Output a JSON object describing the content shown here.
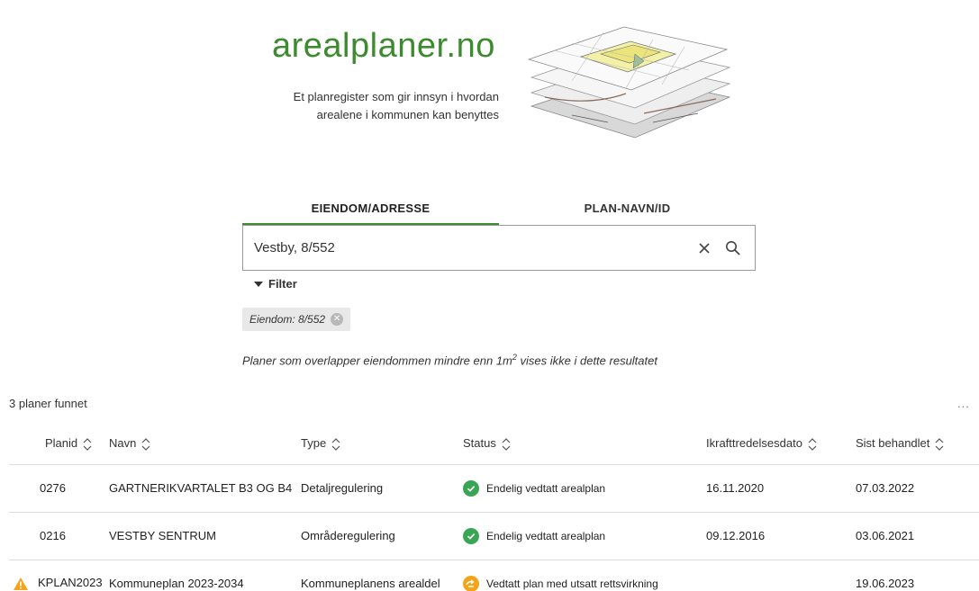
{
  "header": {
    "title": "arealplaner.no",
    "subtitle": "Et planregister som gir innsyn i hvordan arealene i kommunen kan benyttes"
  },
  "tabs": [
    {
      "label": "EIENDOM/ADRESSE",
      "active": true
    },
    {
      "label": "PLAN-NAVN/ID",
      "active": false
    }
  ],
  "search": {
    "value": "Vestby, 8/552",
    "clear_icon": "close-icon",
    "search_icon": "search-icon"
  },
  "filter": {
    "label": "Filter",
    "chip_label": "Eiendom: 8/552"
  },
  "note": {
    "before": "Planer som overlapper eiendommen mindre enn 1m",
    "sup": "2",
    "after": " vises ikke i dette resultatet"
  },
  "results": {
    "count_label": "3 planer funnet",
    "more_label": "...",
    "columns": [
      "Planid",
      "Navn",
      "Type",
      "Status",
      "Ikrafttredelsesdato",
      "Sist behandlet"
    ],
    "rows": [
      {
        "planid": "0276",
        "navn": "GARTNERIKVARTALET B3 OG B4",
        "type": "Detaljregulering",
        "status": "Endelig vedtatt arealplan",
        "status_kind": "approved",
        "ikraft": "16.11.2020",
        "sist": "07.03.2022",
        "warning": false
      },
      {
        "planid": "0216",
        "navn": "VESTBY SENTRUM",
        "type": "Områderegulering",
        "status": "Endelig vedtatt arealplan",
        "status_kind": "approved",
        "ikraft": "09.12.2016",
        "sist": "03.06.2021",
        "warning": false
      },
      {
        "planid": "KPLAN2023",
        "navn": "Kommuneplan 2023-2034",
        "type": "Kommuneplanens arealdel",
        "status": "Vedtatt plan med utsatt rettsvirkning",
        "status_kind": "deferred",
        "ikraft": "",
        "sist": "19.06.2023",
        "warning": true
      }
    ]
  },
  "colors": {
    "brand": "#3d8b2f",
    "approved": "#3aa655",
    "deferred": "#f2a51a",
    "warning": "#f2a51a"
  }
}
